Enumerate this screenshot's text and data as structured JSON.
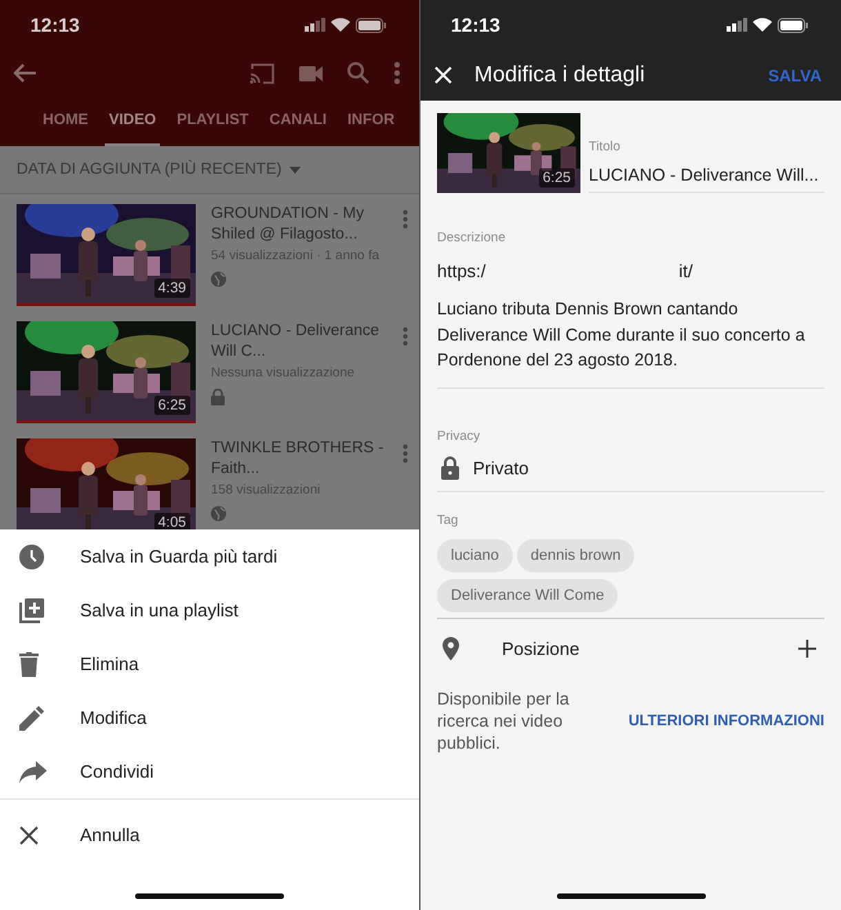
{
  "left_screen": {
    "status_bar": {
      "time": "12:13"
    },
    "tabs": [
      {
        "label": "HOME",
        "selected": false
      },
      {
        "label": "VIDEO",
        "selected": true
      },
      {
        "label": "PLAYLIST",
        "selected": false
      },
      {
        "label": "CANALI",
        "selected": false
      },
      {
        "label": "INFOR",
        "selected": false
      }
    ],
    "sort": {
      "label": "DATA DI AGGIUNTA (PIÙ RECENTE)"
    },
    "videos": [
      {
        "title": "GROUNDATION - My Shiled @ Filagosto...",
        "meta": "54 visualizzazioni · 1 anno fa",
        "duration": "4:39",
        "private": false
      },
      {
        "title": "LUCIANO - Deliverance Will C...",
        "meta": "Nessuna visualizzazione",
        "duration": "6:25",
        "private": true
      },
      {
        "title": "TWINKLE BROTHERS - Faith...",
        "meta": "158 visualizzazioni",
        "duration": "4:05",
        "private": false
      }
    ],
    "menu": [
      {
        "label": "Salva in Guarda più tardi",
        "kind": "clock"
      },
      {
        "label": "Salva in una playlist",
        "kind": "playlist"
      },
      {
        "label": "Elimina",
        "kind": "trash"
      },
      {
        "label": "Modifica",
        "kind": "pencil"
      },
      {
        "label": "Condividi",
        "kind": "share"
      },
      {
        "label": "Annulla",
        "kind": "cancel"
      }
    ]
  },
  "right_screen": {
    "status_bar": {
      "time": "12:13"
    },
    "header": {
      "title": "Modifica i dettagli",
      "save": "SALVA"
    },
    "thumbnail": {
      "duration": "6:25"
    },
    "title_field": {
      "label": "Titolo",
      "value": "LUCIANO - Deliverance Will..."
    },
    "description": {
      "label": "Descrizione",
      "url_start": "https:/",
      "url_end": "it/",
      "text": "Luciano tributa Dennis Brown cantando Deliverance Will Come durante il suo concerto a Pordenone del 23 agosto 2018."
    },
    "privacy": {
      "label": "Privacy",
      "value": "Privato"
    },
    "tags": {
      "label": "Tag",
      "items": [
        "luciano",
        "dennis brown",
        "Deliverance Will Come"
      ]
    },
    "location": {
      "label": "Posizione"
    },
    "info": {
      "text": "Disponibile per la ricerca nei video pubblici.",
      "link": "ULTERIORI INFORMAZIONI"
    }
  }
}
